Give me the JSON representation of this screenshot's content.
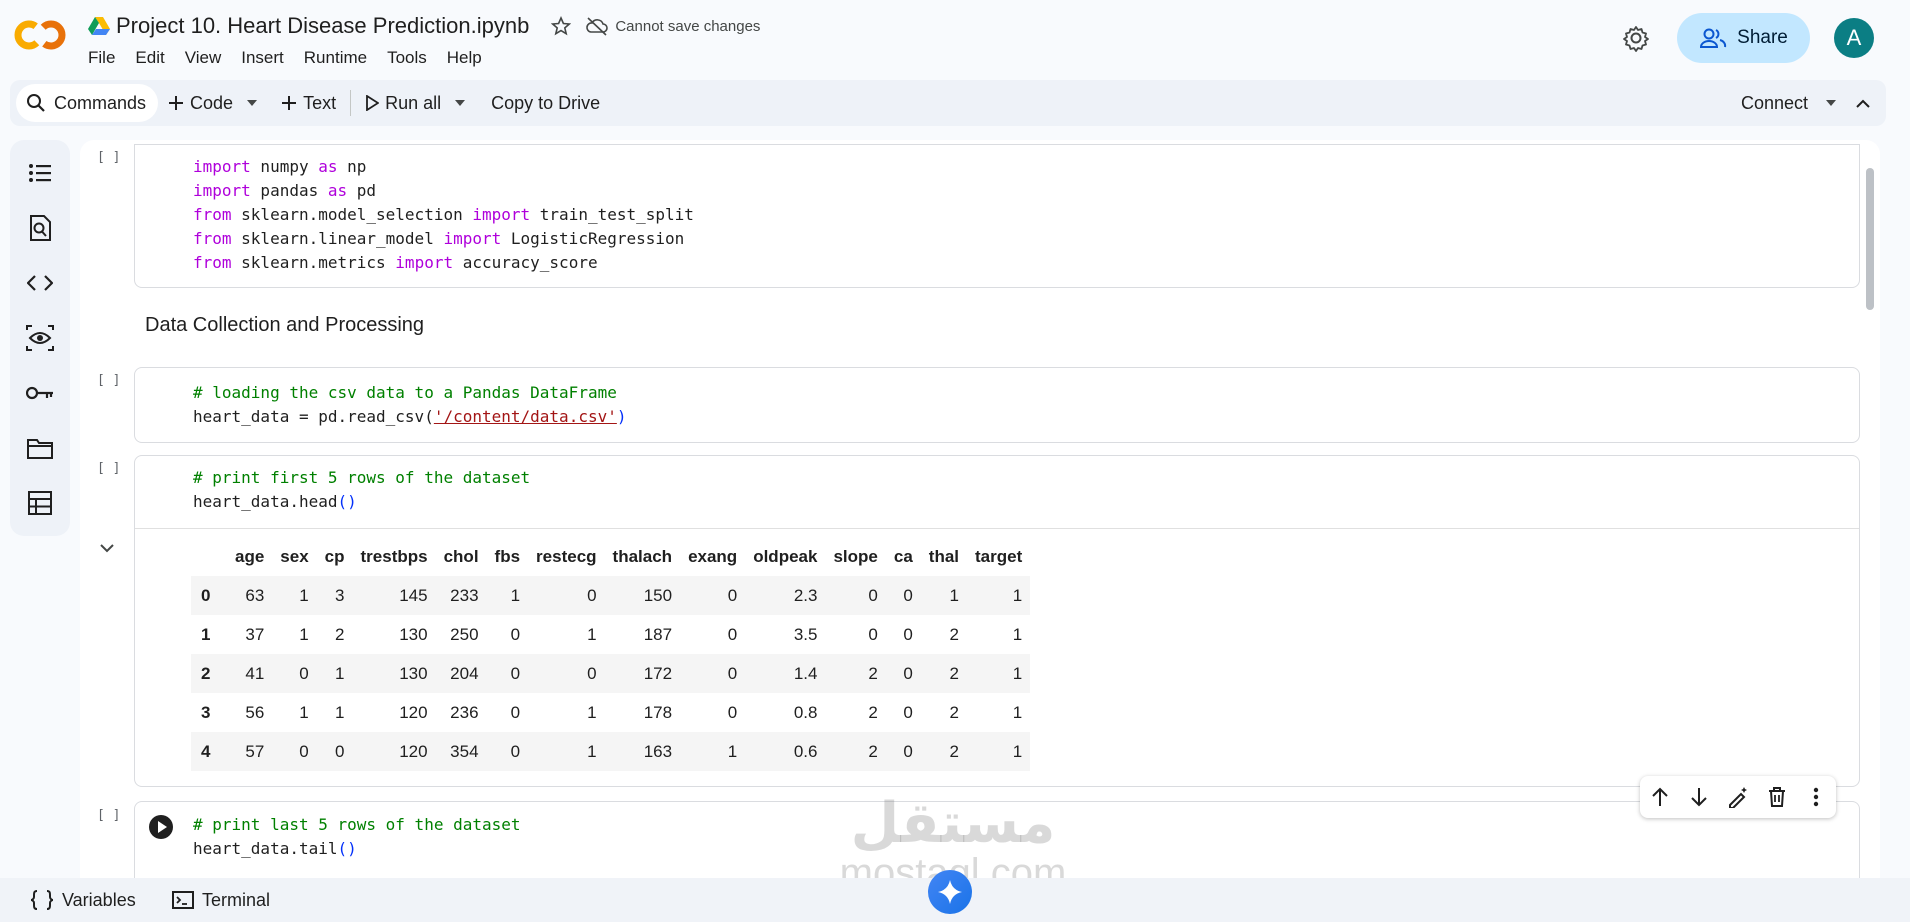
{
  "app": {
    "doc_title": "Project 10. Heart Disease Prediction.ipynb",
    "save_status": "Cannot save changes",
    "share_label": "Share",
    "avatar_letter": "A",
    "accent_color": "#c2e7ff",
    "avatar_color": "#0b7e84"
  },
  "menu": [
    "File",
    "Edit",
    "View",
    "Insert",
    "Runtime",
    "Tools",
    "Help"
  ],
  "toolbar": {
    "commands_label": "Commands",
    "code_label": "Code",
    "text_label": "Text",
    "run_all_label": "Run all",
    "copy_label": "Copy to Drive",
    "connect_label": "Connect"
  },
  "sidebar_icons": [
    "table-of-contents-icon",
    "find-icon",
    "code-snippets-icon",
    "secrets-eye-icon",
    "key-icon",
    "files-folder-icon",
    "data-table-icon"
  ],
  "cells": {
    "bracket": "[ ]",
    "imports": [
      "import numpy as np",
      "import pandas as pd",
      "from sklearn.model_selection import train_test_split",
      "from sklearn.linear_model import LogisticRegression",
      "from sklearn.metrics import accuracy_score"
    ],
    "markdown_heading": "Data Collection and Processing",
    "load_comment": "# loading the csv data to a Pandas DataFrame",
    "load_code_prefix": "heart_data = pd.read_csv(",
    "load_code_string": "'/content/data.csv'",
    "load_code_suffix": ")",
    "head_comment": "# print first 5 rows of the dataset",
    "head_code": "heart_data.head",
    "tail_comment": "# print last 5 rows of the dataset",
    "tail_code": "heart_data.tail",
    "call_parens": "()"
  },
  "dataframe": {
    "columns": [
      "",
      "age",
      "sex",
      "cp",
      "trestbps",
      "chol",
      "fbs",
      "restecg",
      "thalach",
      "exang",
      "oldpeak",
      "slope",
      "ca",
      "thal",
      "target"
    ],
    "rows": [
      [
        "0",
        "63",
        "1",
        "3",
        "145",
        "233",
        "1",
        "0",
        "150",
        "0",
        "2.3",
        "0",
        "0",
        "1",
        "1"
      ],
      [
        "1",
        "37",
        "1",
        "2",
        "130",
        "250",
        "0",
        "1",
        "187",
        "0",
        "3.5",
        "0",
        "0",
        "2",
        "1"
      ],
      [
        "2",
        "41",
        "0",
        "1",
        "130",
        "204",
        "0",
        "0",
        "172",
        "0",
        "1.4",
        "2",
        "0",
        "2",
        "1"
      ],
      [
        "3",
        "56",
        "1",
        "1",
        "120",
        "236",
        "0",
        "1",
        "178",
        "0",
        "0.8",
        "2",
        "0",
        "2",
        "1"
      ],
      [
        "4",
        "57",
        "0",
        "0",
        "120",
        "354",
        "0",
        "1",
        "163",
        "1",
        "0.6",
        "2",
        "0",
        "2",
        "1"
      ]
    ]
  },
  "statusbar": {
    "variables_label": "Variables",
    "terminal_label": "Terminal"
  },
  "watermark": {
    "arabic": "مستقل",
    "latin": "mostaql.com"
  }
}
